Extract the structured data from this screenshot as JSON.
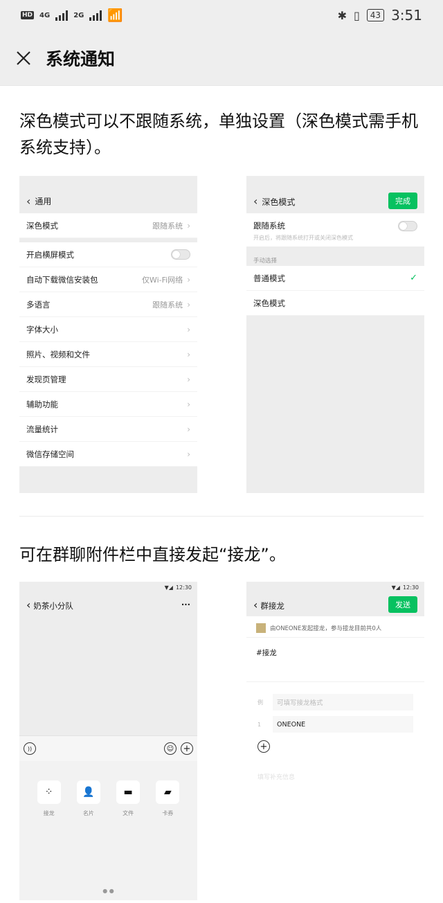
{
  "status_bar": {
    "hd": "HD",
    "net1": "4G",
    "net2": "2G",
    "battery": "43",
    "time": "3:51"
  },
  "app_bar": {
    "title": "系统通知"
  },
  "section1": {
    "text": "深色模式可以不跟随系统，单独设置（深色模式需手机系统支持）。",
    "left_screen": {
      "title": "通用",
      "rows": [
        {
          "label": "深色模式",
          "value": "跟随系统"
        },
        {
          "label": "开启横屏模式",
          "value": ""
        },
        {
          "label": "自动下载微信安装包",
          "value": "仅Wi-Fi网络"
        },
        {
          "label": "多语言",
          "value": "跟随系统"
        },
        {
          "label": "字体大小",
          "value": ""
        },
        {
          "label": "照片、视频和文件",
          "value": ""
        },
        {
          "label": "发现页管理",
          "value": ""
        },
        {
          "label": "辅助功能",
          "value": ""
        },
        {
          "label": "流量统计",
          "value": ""
        },
        {
          "label": "微信存储空间",
          "value": ""
        }
      ]
    },
    "right_screen": {
      "title": "深色模式",
      "done": "完成",
      "follow_system": "跟随系统",
      "follow_hint": "开启后，将跟随系统打开或关闭深色模式",
      "manual_label": "手动选择",
      "normal_mode": "普通模式",
      "dark_mode": "深色模式"
    }
  },
  "section2": {
    "text": "可在群聊附件栏中直接发起“接龙”。",
    "left_screen": {
      "time": "12:30",
      "chat_title": "奶茶小分队",
      "more": "···",
      "attachments": [
        {
          "icon": "relay-icon",
          "label": "接龙"
        },
        {
          "icon": "contact-card-icon",
          "label": "名片"
        },
        {
          "icon": "folder-icon",
          "label": "文件"
        },
        {
          "icon": "coupon-icon",
          "label": "卡券"
        }
      ]
    },
    "right_screen": {
      "time": "12:30",
      "title": "群接龙",
      "send": "发送",
      "info": "由ONEONE发起接龙，参与接龙目前共0人",
      "hashtag": "#接龙",
      "example_label": "例",
      "example_placeholder": "可填写接龙格式",
      "item1_num": "1",
      "item1_value": "ONEONE",
      "supplement": "填写补充信息"
    }
  }
}
